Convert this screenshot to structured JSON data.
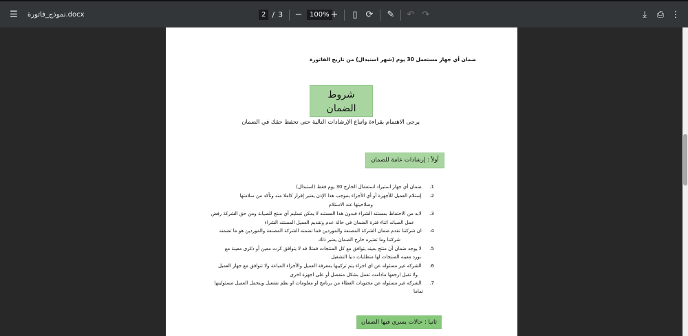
{
  "toolbar": {
    "file_name": "نموذج_فاتورة.docx",
    "current_page": "2",
    "page_sep": "/",
    "total_pages": "3",
    "zoom": "100%"
  },
  "doc": {
    "intro": "ضمان أي جهاز مستعمل 30 يوم (شهر استبدال) من تاريخ الفاتورة",
    "title_line1": "شروط",
    "title_line2": "الضمان",
    "subtitle": "يرجى الاهتمام بقراءة واتباع الإرشادات التالية حتى تحفظ حقك في الضمان",
    "section1": "أولاً : إرشادات عامة للضمان",
    "items": [
      {
        "num": "1.",
        "lines": [
          "ضمان أي جهاز استيراد استعمال الخارج 30 يوم فقط (استبدال)"
        ]
      },
      {
        "num": "2.",
        "lines": [
          "إستلام العميل للأجهزة أو أي الأجزاء بموجب هذا الإذن يعتبر إقرار كاملا منه وتأكد من سلامتها",
          "وصلاحيتها عند الاستلام"
        ]
      },
      {
        "num": "3.",
        "lines": [
          "لابد من الاحتفاظ بمستند الشراء فبدون هذا المستند لا يمكن تسليم أي منتج للصيانة ومن حق الشركة رفض",
          "عمل الصيانه اثناء فترة الضمان في حالة عدم وتقديم العميل المستند الشراء"
        ]
      },
      {
        "num": "4.",
        "lines": [
          "ان شركتنا تقدم ضمان الشركة المصنعة والموردين فما تضمنه الشركة المصنعة والموردين هو ما تضمنه",
          "شركتنا وما تعتبره خارج الضمان يعتبر ذلك"
        ]
      },
      {
        "num": "5.",
        "lines": [
          "لا يوجد ضمان أن منتج بعينه يتوافق مع كل المنتجات فمثلا قد لا يتوافق كرت معين أو ذكرى معينة  مع",
          "بورد معينه المنتجات لها متطلبات دنيا التشغيل"
        ]
      },
      {
        "num": "6.",
        "lines": [
          "الشركه غير مسئوله عن اي اجزاء يتم تركيبها بمعرفة العميل والأجزاء المباعة ولا تتوافق مع جهاز العميل",
          "ولا تقبل ارجعها مادامت تعمل بشكل منفصل أو  على اجهزة اخرى"
        ]
      },
      {
        "num": "7.",
        "lines": [
          "الشركه غير مسئوله عن  محتويات الغطاء من برنامج او معلومات او نظم تشغيل ويتحمل العميل مسئوليتها",
          "تماما"
        ]
      }
    ],
    "section2": "ثانيا : حالات يسري فيها الضمان"
  }
}
